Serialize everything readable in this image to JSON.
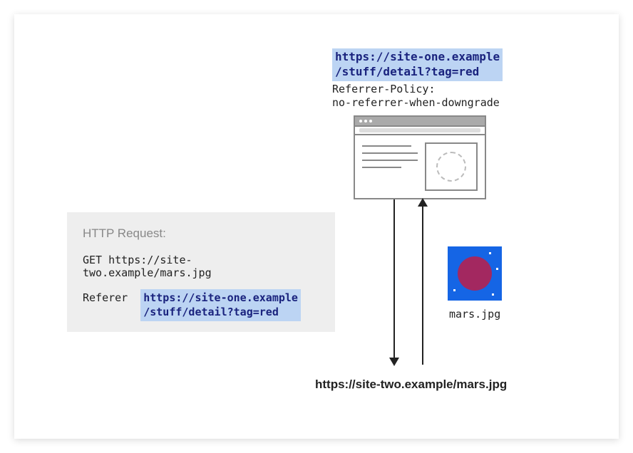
{
  "siteOne": {
    "url": "https://site-one.example\n/stuff/detail?tag=red",
    "referrerPolicy": "Referrer-Policy:\nno-referrer-when-downgrade"
  },
  "httpRequest": {
    "title": "HTTP Request:",
    "getLine": "GET https://site-two.example/mars.jpg",
    "refererLabel": "Referer",
    "refererValue": "https://site-one.example\n/stuff/detail?tag=red"
  },
  "marsImage": {
    "filename": "mars.jpg"
  },
  "siteTwo": {
    "url": "https://site-two.example/mars.jpg"
  },
  "icons": {
    "browserWindow": "browser-window-icon",
    "imagePlaceholder": "dashed-circle-placeholder",
    "marsPlanet": "mars-planet-icon",
    "arrowDown": "arrow-down-icon",
    "arrowUp": "arrow-up-icon"
  },
  "colors": {
    "highlightBg": "#bcd4f3",
    "highlightText": "#1a237e",
    "boxBg": "#eeeeee",
    "marsBg": "#1565e5",
    "marsPlanet": "#a32860"
  }
}
